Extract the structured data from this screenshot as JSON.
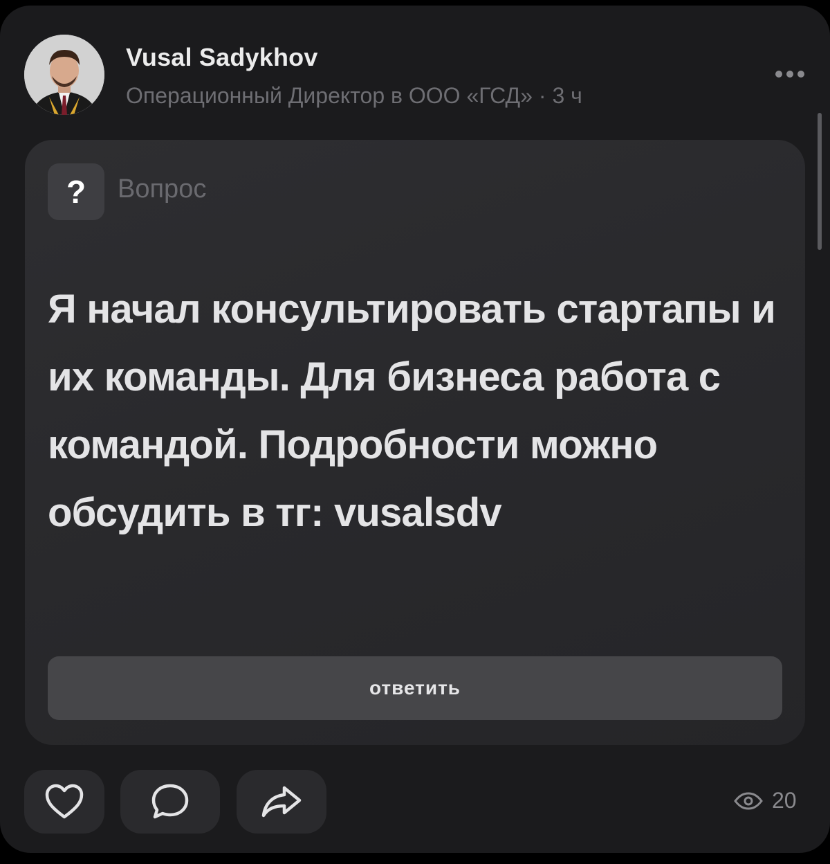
{
  "post": {
    "author_name": "Vusal Sadykhov",
    "author_meta": "Операционный Директор в ООО «ГСД» · 3 ч",
    "more_icon": "more-horizontal-icon"
  },
  "question": {
    "badge_symbol": "?",
    "label": "Вопрос",
    "text": "Я начал консультировать стартапы и их команды. Для бизнеса работа с командой. Подробности можно обсудить в тг: vusalsdv",
    "answer_label": "ответить"
  },
  "actions": {
    "like_icon": "heart-icon",
    "comment_icon": "comment-icon",
    "share_icon": "share-icon"
  },
  "stats": {
    "views_icon": "eye-icon",
    "views": "20"
  },
  "colors": {
    "background": "#1b1b1d",
    "card": "#2b2b2e",
    "button": "#464649",
    "text_primary": "#e4e4e6",
    "text_secondary": "#6e6e73"
  }
}
